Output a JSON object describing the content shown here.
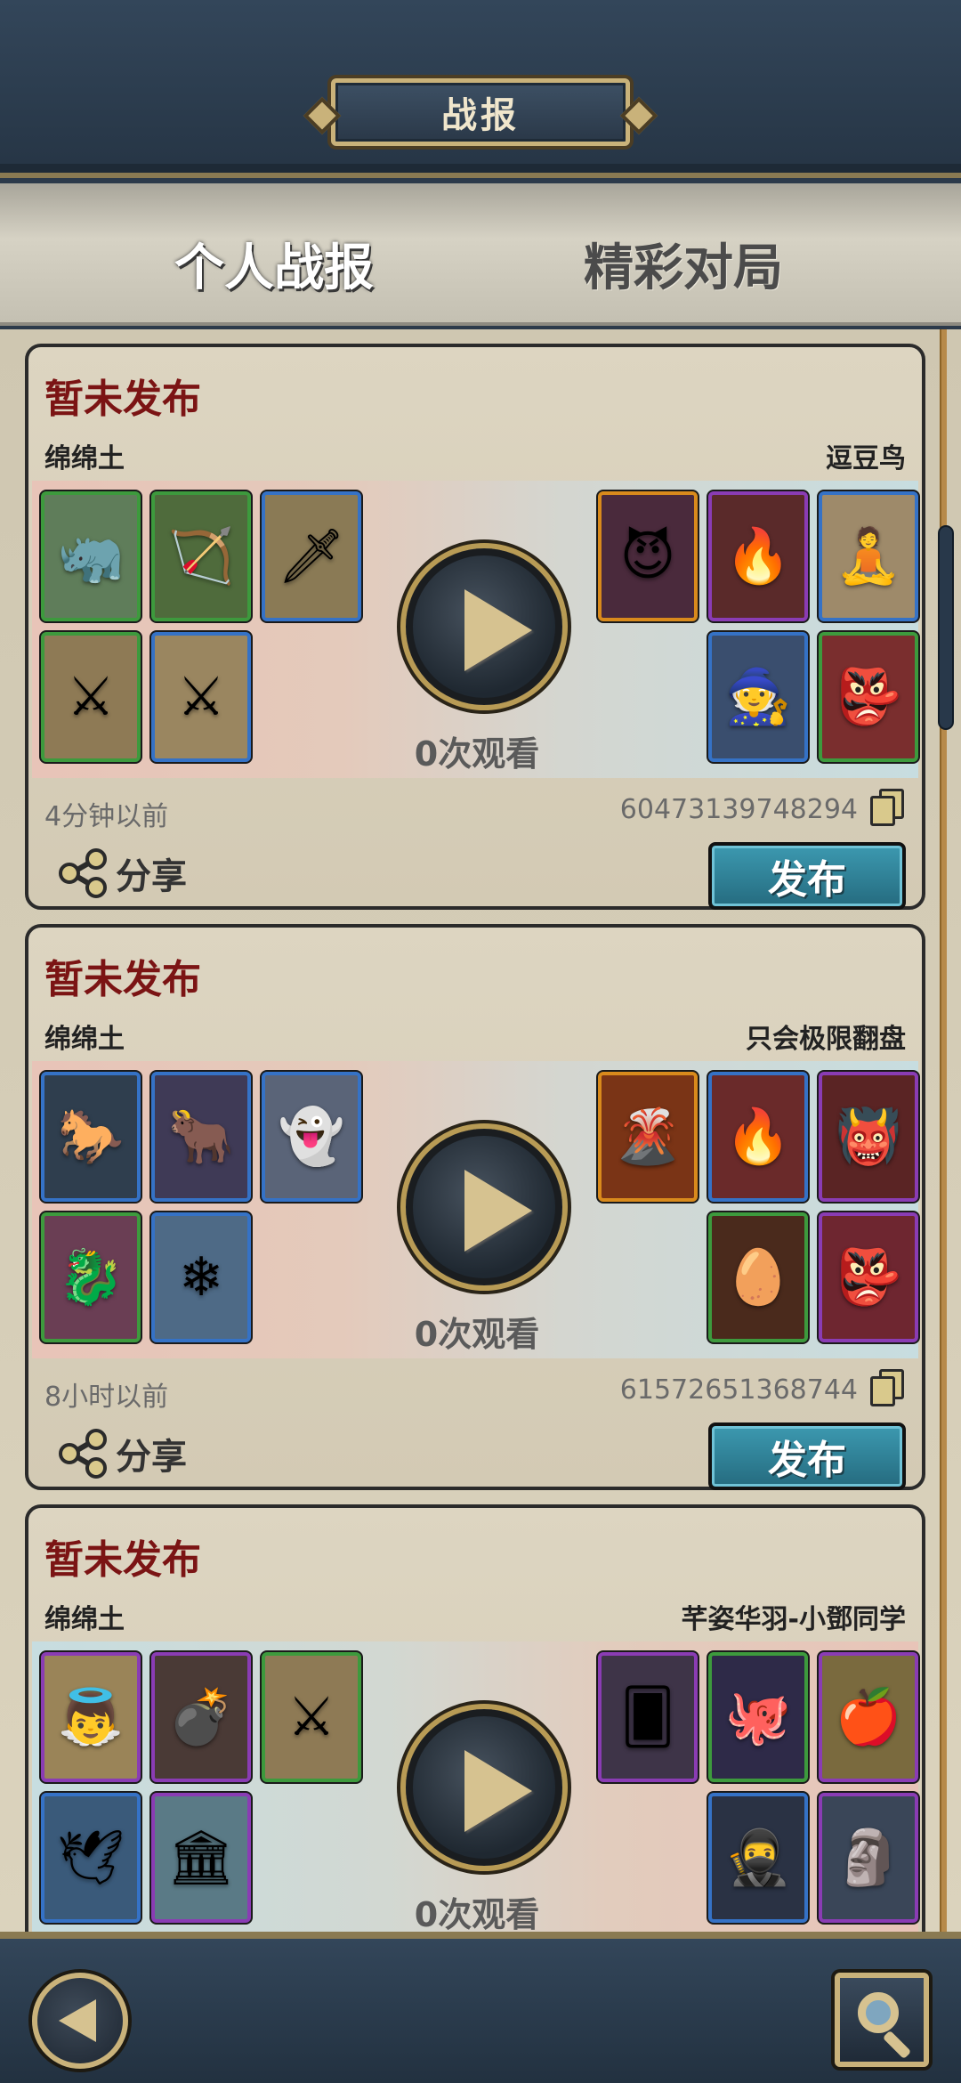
{
  "header": {
    "title": "战报"
  },
  "tabs": [
    {
      "label": "个人战报",
      "active": true
    },
    {
      "label": "精彩对局",
      "active": false
    }
  ],
  "reports": [
    {
      "status": "暂未发布",
      "player_left": "绵绵土",
      "player_right": "逗豆鸟",
      "views": "0次观看",
      "time": "4分钟以前",
      "replay_id": "60473139748294",
      "share_label": "分享",
      "publish_label": "发布",
      "left_units": [
        {
          "icon": "rhino-beast-icon",
          "glyph": "🦏",
          "rarity": "green"
        },
        {
          "icon": "centaur-archer-icon",
          "glyph": "🏹",
          "rarity": "green"
        },
        {
          "icon": "spear-warrior-icon",
          "glyph": "🗡",
          "rarity": "blue"
        },
        {
          "icon": "sword-warrior-icon",
          "glyph": "⚔",
          "rarity": "green"
        },
        {
          "icon": "dual-blade-warrior-icon",
          "glyph": "⚔",
          "rarity": "blue"
        }
      ],
      "right_units": [
        {
          "icon": "demon-queen-icon",
          "glyph": "😈",
          "rarity": "orange"
        },
        {
          "icon": "fire-demon-icon",
          "glyph": "🔥",
          "rarity": "purple"
        },
        {
          "icon": "monk-sage-icon",
          "glyph": "🧘",
          "rarity": "blue"
        },
        {
          "icon": "dark-wizard-icon",
          "glyph": "🧙",
          "rarity": "blue"
        },
        {
          "icon": "imp-miner-icon",
          "glyph": "👺",
          "rarity": "green"
        }
      ]
    },
    {
      "status": "暂未发布",
      "player_left": "绵绵土",
      "player_right": "只会极限翻盘",
      "views": "0次观看",
      "time": "8小时以前",
      "replay_id": "61572651368744",
      "share_label": "分享",
      "publish_label": "发布",
      "left_units": [
        {
          "icon": "spectral-horse-icon",
          "glyph": "🐎",
          "rarity": "blue"
        },
        {
          "icon": "horned-beast-icon",
          "glyph": "🐂",
          "rarity": "blue"
        },
        {
          "icon": "frost-spirit-icon",
          "glyph": "👻",
          "rarity": "blue"
        },
        {
          "icon": "red-dragon-icon",
          "glyph": "🐉",
          "rarity": "green"
        },
        {
          "icon": "ice-sorceress-icon",
          "glyph": "❄",
          "rarity": "blue"
        }
      ],
      "right_units": [
        {
          "icon": "lava-golem-icon",
          "glyph": "🌋",
          "rarity": "orange"
        },
        {
          "icon": "fire-mage-icon",
          "glyph": "🔥",
          "rarity": "blue"
        },
        {
          "icon": "flame-ogre-icon",
          "glyph": "👹",
          "rarity": "purple"
        },
        {
          "icon": "fire-egg-icon",
          "glyph": "🥚",
          "rarity": "green"
        },
        {
          "icon": "imp-icon",
          "glyph": "👺",
          "rarity": "purple"
        }
      ]
    },
    {
      "status": "暂未发布",
      "player_left": "绵绵土",
      "player_right": "芊姿华羽-小鄧同学",
      "views": "0次观看",
      "left_units": [
        {
          "icon": "winged-angel-icon",
          "glyph": "👼",
          "rarity": "purple"
        },
        {
          "icon": "cannon-icon",
          "glyph": "💣",
          "rarity": "purple"
        },
        {
          "icon": "sword-warrior-icon",
          "glyph": "⚔",
          "rarity": "green"
        },
        {
          "icon": "sea-bird-icon",
          "glyph": "🕊",
          "rarity": "blue"
        },
        {
          "icon": "temple-icon",
          "glyph": "🏛",
          "rarity": "purple"
        }
      ],
      "right_units": [
        {
          "icon": "tarot-card-icon",
          "glyph": "🂠",
          "rarity": "purple"
        },
        {
          "icon": "shadow-beast-icon",
          "glyph": "🐙",
          "rarity": "green"
        },
        {
          "icon": "golden-apple-icon",
          "glyph": "🍎",
          "rarity": "purple"
        },
        {
          "icon": "hooded-thief-icon",
          "glyph": "🥷",
          "rarity": "blue"
        },
        {
          "icon": "obelisk-icon",
          "glyph": "🗿",
          "rarity": "purple"
        }
      ]
    }
  ],
  "colors": {
    "status_red": "#7b1414",
    "publish_teal": "#2f8aa2",
    "frame_gold": "#c9b27a"
  },
  "footer": {
    "back_icon": "back-arrow-icon",
    "search_icon": "search-icon"
  }
}
